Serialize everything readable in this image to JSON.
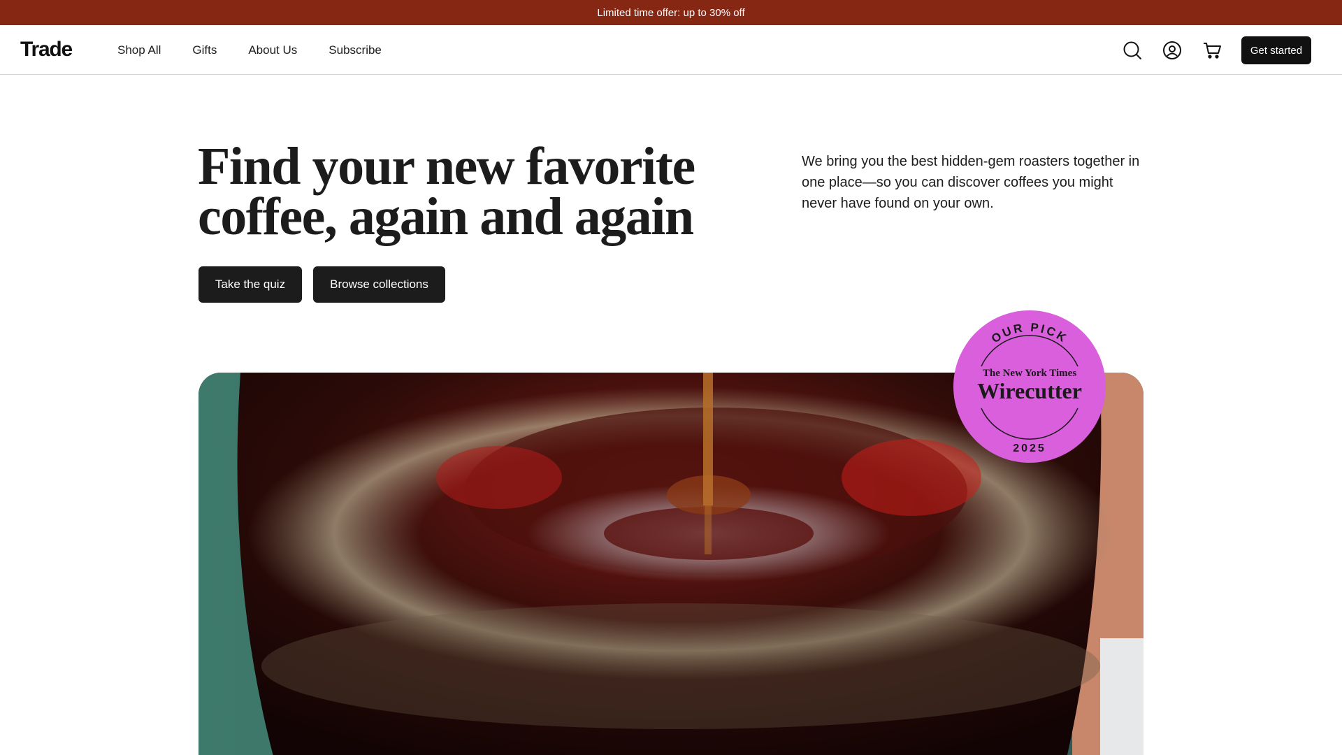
{
  "promo": {
    "text": "Limited time offer: up to 30% off"
  },
  "nav": {
    "logo": "Trade",
    "links": [
      "Shop All",
      "Gifts",
      "About Us",
      "Subscribe"
    ],
    "icons": [
      "search-icon",
      "account-icon",
      "cart-icon"
    ],
    "cta": "Get started"
  },
  "hero": {
    "title_line1": "Find your new favorite",
    "title_line2": "coffee, again and again",
    "description": "We bring you the best hidden-gem roasters together in one place—so you can discover coffees you might never have found on your own.",
    "buttons": {
      "quiz": "Take the quiz",
      "browse": "Browse collections"
    }
  },
  "badge": {
    "top": "OUR PICK",
    "publisher": "The New York Times",
    "brand": "Wirecutter",
    "year": "2025",
    "color": "#d95fdc"
  },
  "colors": {
    "promo_bg": "#862714",
    "button_bg": "#1c1c1c",
    "text": "#1c1c1c"
  }
}
